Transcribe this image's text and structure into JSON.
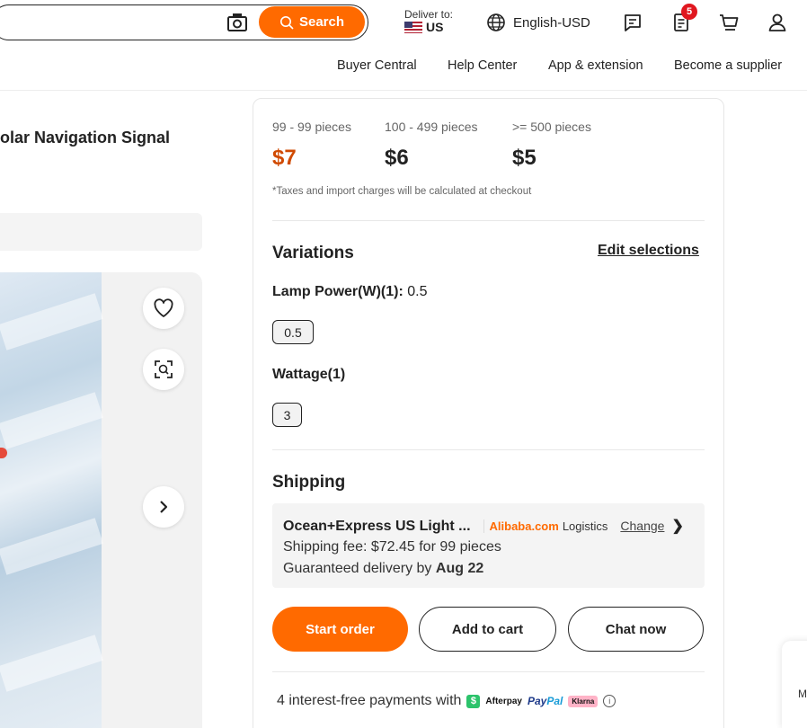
{
  "header": {
    "search_label": "Search",
    "deliver_to_label": "Deliver to:",
    "deliver_country": "US",
    "language_currency": "English-USD",
    "notifications_count": "5"
  },
  "subnav": [
    "Buyer Central",
    "Help Center",
    "App & extension",
    "Become a supplier"
  ],
  "product": {
    "title_fragment": "olar Navigation Signal"
  },
  "pricing": {
    "tiers": [
      {
        "range": "99 - 99 pieces",
        "price": "$7"
      },
      {
        "range": "100 - 499 pieces",
        "price": "$6"
      },
      {
        "range": ">= 500 pieces",
        "price": "$5"
      }
    ],
    "tax_note": "*Taxes and import charges will be calculated at checkout"
  },
  "variations": {
    "heading": "Variations",
    "edit_label": "Edit selections",
    "lamp_power_label": "Lamp Power(W)(1):",
    "lamp_power_value": "0.5",
    "lamp_power_option": "0.5",
    "wattage_label": "Wattage(1)",
    "wattage_option": "3"
  },
  "shipping": {
    "heading": "Shipping",
    "method": "Ocean+Express US Light ...",
    "provider": "Alibaba.com",
    "provider_suffix": "Logistics",
    "change_label": "Change",
    "fee": "Shipping fee: $72.45 for 99 pieces",
    "delivery_prefix": "Guaranteed delivery by",
    "delivery_date": "Aug 22"
  },
  "actions": {
    "start_order": "Start order",
    "add_to_cart": "Add to cart",
    "chat_now": "Chat now"
  },
  "payments": {
    "text": "4 interest-free payments with",
    "afterpay": "Afterpay",
    "paypal_a": "Pay",
    "paypal_b": "Pal",
    "klarna": "Klarna"
  },
  "floating": {
    "letter": "M"
  },
  "colors": {
    "accent": "#ff6a00",
    "price_highlight": "#d04a02",
    "badge": "#e0171f"
  }
}
